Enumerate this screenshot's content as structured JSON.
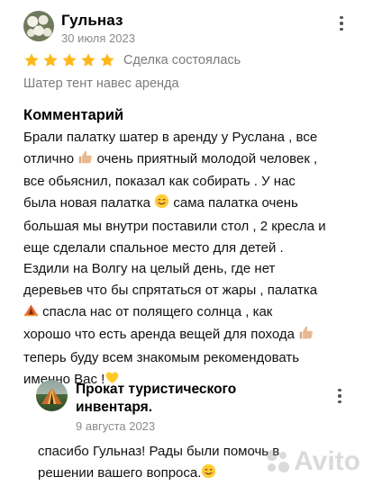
{
  "review": {
    "author": "Гульназ",
    "date": "30 июля 2023",
    "rating": 5,
    "deal_status": "Сделка состоялась",
    "item_title": "Шатер тент навес аренда",
    "comment_heading": "Комментарий",
    "comment_lines": [
      "Брали палатку шатер в аренду у Руслана , все",
      "отлично [thumbs-up] очень приятный молодой человек ,",
      "все обьяснил,  показал как собирать . У нас",
      "была новая палатка [smile] сама палатка очень",
      "большая мы внутри поставили стол , 2 кресла и",
      "еще сделали спальное место для детей .",
      "Ездили на Волгу на целый день, где нет",
      "деревьев что бы спрятаться от жары , палатка",
      "[tent] спасла нас от полящего солнца , как",
      "хорошо что есть аренда вещей для похода [thumbs-up]",
      "теперь буду всем знакомым рекомендовать",
      "именно Вас ![heart]"
    ]
  },
  "reply": {
    "author": "Прокат туристического инвентаря.",
    "date": "9 августа 2023",
    "text_lines": [
      "спасибо Гульназ! Рады были помочь в",
      "решении вашего вопроса.[smile]"
    ]
  },
  "colors": {
    "star": "#ffb81c",
    "muted_text": "#7b7b7b",
    "date_text": "#8a8a8a"
  },
  "icons": [
    "more-vertical-icon",
    "star-icon",
    "thumbs-up-emoji",
    "smile-emoji",
    "tent-emoji",
    "heart-emoji",
    "avito-logo"
  ],
  "watermark_text": "Avito"
}
